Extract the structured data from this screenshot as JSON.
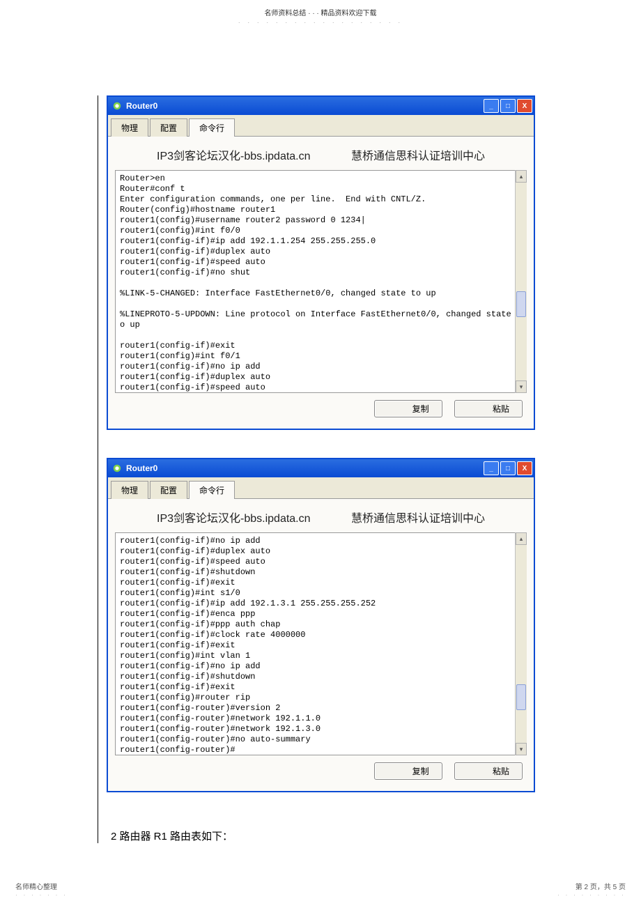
{
  "page_header": {
    "text": "名师资料总结 · · · 精品资料欢迎下载",
    "dots": "· · · · · · · · · · · · · · · · · ·"
  },
  "tabs": {
    "physical": "物理",
    "config": "配置",
    "cli": "命令行"
  },
  "subheader": {
    "left": "IP3剑客论坛汉化-bbs.ipdata.cn",
    "right": "慧桥通信思科认证培训中心"
  },
  "buttons": {
    "copy": "复制",
    "paste": "粘贴"
  },
  "window1": {
    "title": "Router0",
    "terminal": "Router>en\nRouter#conf t\nEnter configuration commands, one per line.  End with CNTL/Z.\nRouter(config)#hostname router1\nrouter1(config)#username router2 password 0 1234|\nrouter1(config)#int f0/0\nrouter1(config-if)#ip add 192.1.1.254 255.255.255.0\nrouter1(config-if)#duplex auto\nrouter1(config-if)#speed auto\nrouter1(config-if)#no shut\n\n%LINK-5-CHANGED: Interface FastEthernet0/0, changed state to up\n\n%LINEPROTO-5-UPDOWN: Line protocol on Interface FastEthernet0/0, changed state t\no up\n\nrouter1(config-if)#exit\nrouter1(config)#int f0/1\nrouter1(config-if)#no ip add\nrouter1(config-if)#duplex auto\nrouter1(config-if)#speed auto"
  },
  "window2": {
    "title": "Router0",
    "terminal": "router1(config-if)#no ip add\nrouter1(config-if)#duplex auto\nrouter1(config-if)#speed auto\nrouter1(config-if)#shutdown\nrouter1(config-if)#exit\nrouter1(config)#int s1/0\nrouter1(config-if)#ip add 192.1.3.1 255.255.255.252\nrouter1(config-if)#enca ppp\nrouter1(config-if)#ppp auth chap\nrouter1(config-if)#clock rate 4000000\nrouter1(config-if)#exit\nrouter1(config)#int vlan 1\nrouter1(config-if)#no ip add\nrouter1(config-if)#shutdown\nrouter1(config-if)#exit\nrouter1(config)#router rip\nrouter1(config-router)#version 2\nrouter1(config-router)#network 192.1.1.0\nrouter1(config-router)#network 192.1.3.0\nrouter1(config-router)#no auto-summary\nrouter1(config-router)#"
  },
  "note": "2 路由器  R1 路由表如下：",
  "footer": {
    "left": "名师精心整理",
    "left_dots": "· · · · · · ·",
    "right": "第 2 页，共 5 页",
    "right_dots": "· · · · · · · · ·"
  },
  "icons": {
    "min": "_",
    "max": "□",
    "close": "X",
    "up": "▴",
    "down": "▾"
  }
}
